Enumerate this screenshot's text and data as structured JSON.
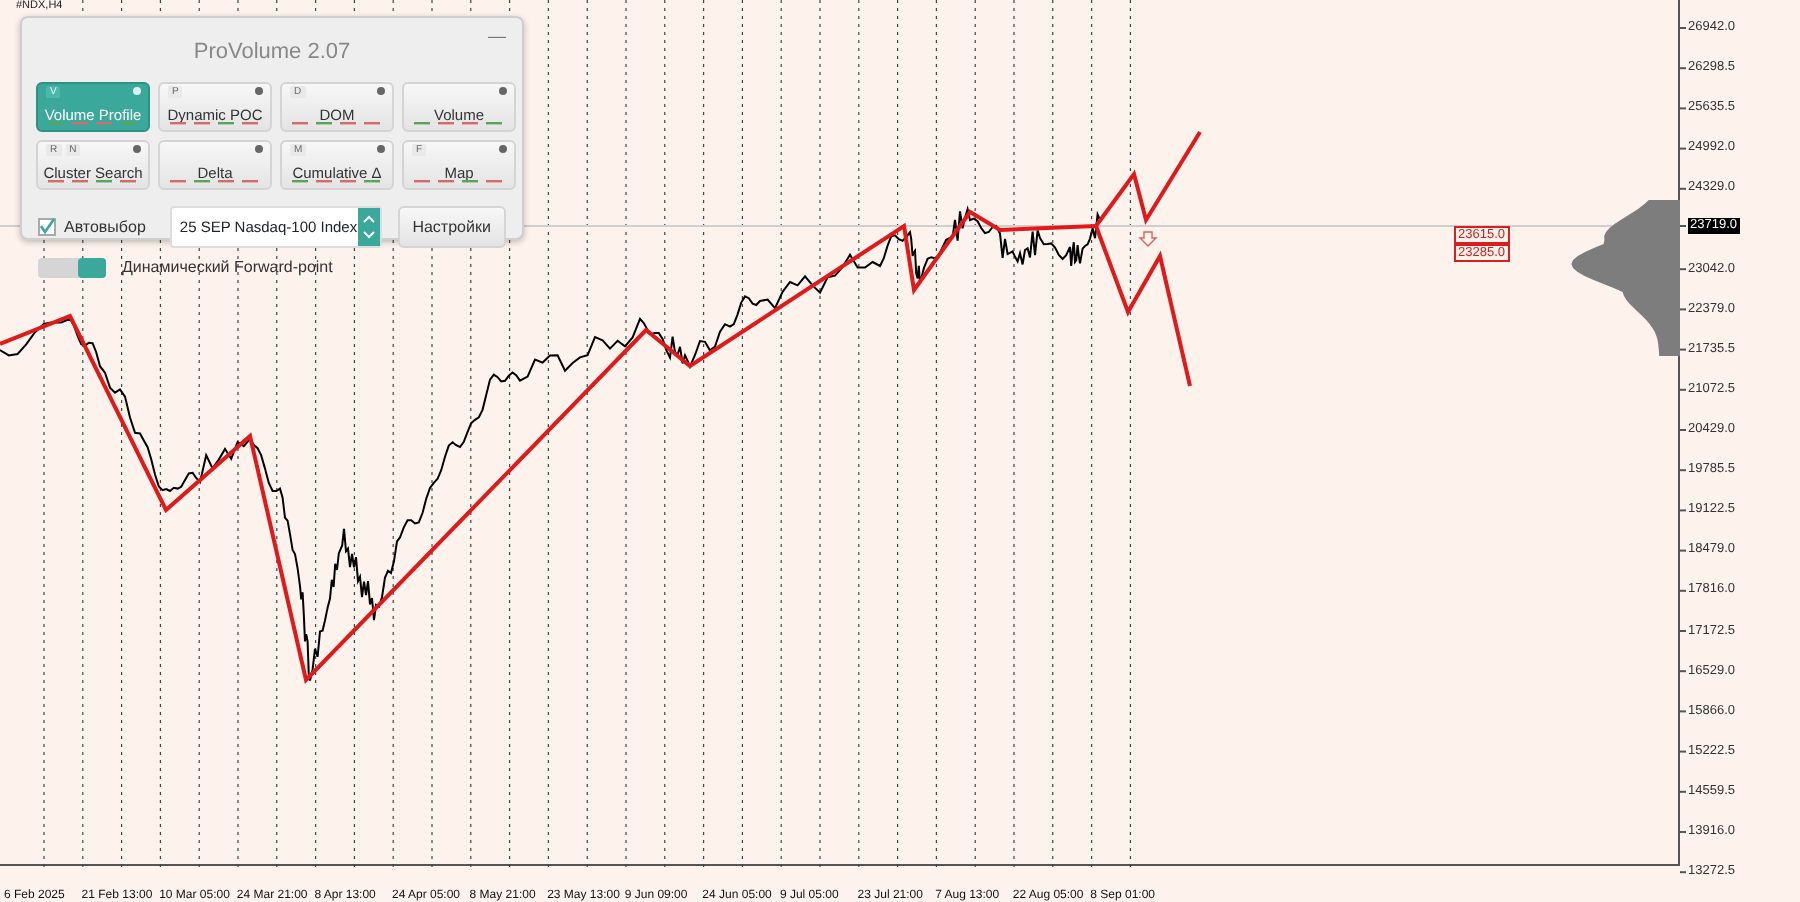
{
  "symbol": "#NDX,H4",
  "panel": {
    "title": "ProVolume 2.07",
    "minimize": "—",
    "modes": [
      {
        "label": "Volume Profile",
        "hotkeys": [
          "V"
        ],
        "selected": true
      },
      {
        "label": "Dynamic POC",
        "hotkeys": [
          "P"
        ],
        "selected": false
      },
      {
        "label": "DOM",
        "hotkeys": [
          "D"
        ],
        "selected": false
      },
      {
        "label": "Volume",
        "selected": false
      },
      {
        "label": "Cluster Search",
        "hotkeys": [
          "R",
          "N"
        ],
        "selected": false
      },
      {
        "label": "Delta",
        "selected": false
      },
      {
        "label": "Cumulative Δ",
        "hotkeys": [
          "M"
        ],
        "selected": false
      },
      {
        "label": "Map",
        "hotkeys": [
          "F"
        ],
        "selected": false
      }
    ],
    "auto_select": {
      "label": "Автовыбор",
      "checked": true
    },
    "instrument": "25 SEP Nasdaq-100 Index",
    "settings_button": "Настройки",
    "forward_point": {
      "label": "Динамический Forward-point",
      "on": true
    }
  },
  "price_axis": [
    {
      "label": "26942.0",
      "kind": "tick"
    },
    {
      "label": "26298.5",
      "kind": "tick"
    },
    {
      "label": "25635.5",
      "kind": "tick"
    },
    {
      "label": "24992.0",
      "kind": "tick"
    },
    {
      "label": "24329.0",
      "kind": "tick"
    },
    {
      "label": "23719.0",
      "kind": "current"
    },
    {
      "label": "23042.0",
      "kind": "tick"
    },
    {
      "label": "22379.0",
      "kind": "tick"
    },
    {
      "label": "21735.5",
      "kind": "tick"
    },
    {
      "label": "21072.5",
      "kind": "tick"
    },
    {
      "label": "20429.0",
      "kind": "tick"
    },
    {
      "label": "19785.5",
      "kind": "tick"
    },
    {
      "label": "19122.5",
      "kind": "tick"
    },
    {
      "label": "18479.0",
      "kind": "tick"
    },
    {
      "label": "17816.0",
      "kind": "tick"
    },
    {
      "label": "17172.5",
      "kind": "tick"
    },
    {
      "label": "16529.0",
      "kind": "tick"
    },
    {
      "label": "15866.0",
      "kind": "tick"
    },
    {
      "label": "15222.5",
      "kind": "tick"
    },
    {
      "label": "14559.5",
      "kind": "tick"
    },
    {
      "label": "13916.0",
      "kind": "tick"
    },
    {
      "label": "13272.5",
      "kind": "tick"
    }
  ],
  "levels": [
    "23615.0",
    "23285.0"
  ],
  "time_axis": [
    "6 Feb 2025",
    "21 Feb 13:00",
    "10 Mar 05:00",
    "24 Mar 21:00",
    "8 Apr 13:00",
    "24 Apr 05:00",
    "8 May 21:00",
    "23 May 13:00",
    "9 Jun 09:00",
    "24 Jun 05:00",
    "9 Jul 05:00",
    "23 Jul 21:00",
    "7 Aug 13:00",
    "22 Aug 05:00",
    "8 Sep 01:00"
  ]
}
